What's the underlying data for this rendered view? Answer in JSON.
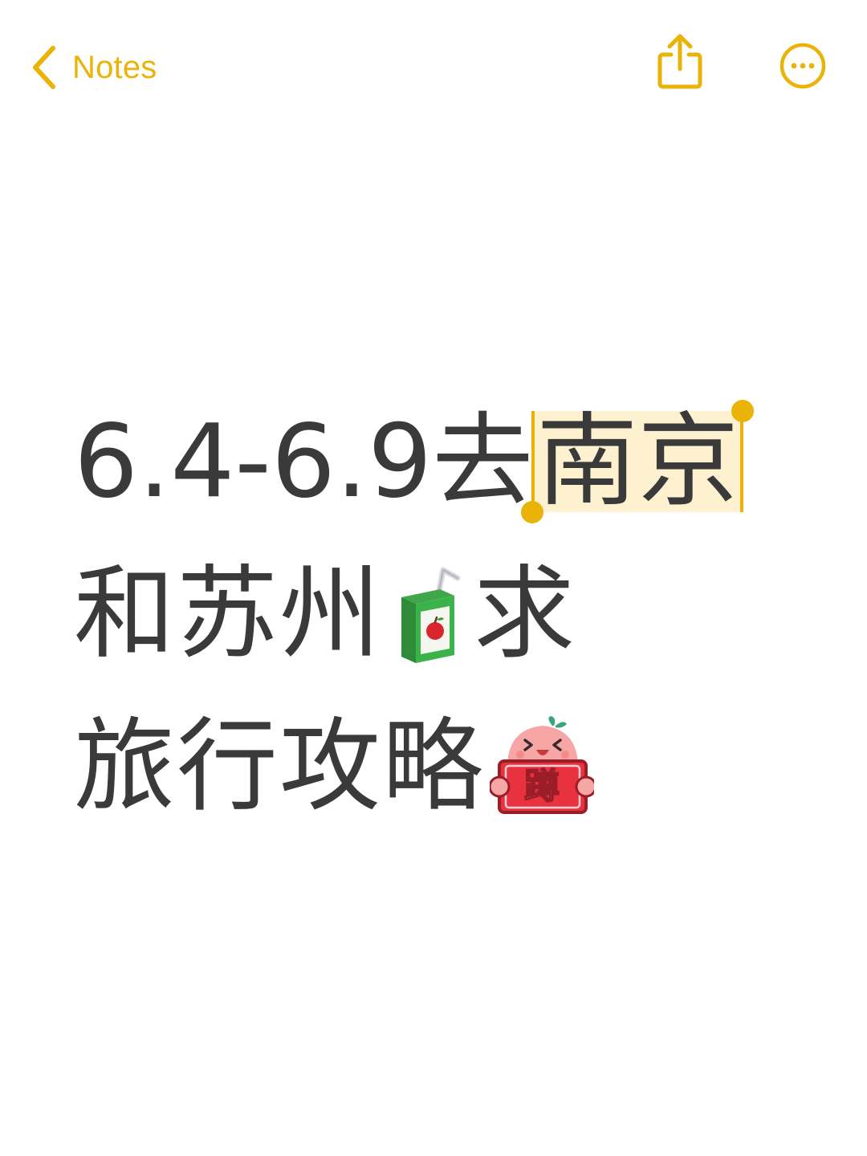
{
  "nav": {
    "back_label": "Notes",
    "back_icon": "chevron-left-icon",
    "share_icon": "share-icon",
    "more_icon": "ellipsis-circle-icon",
    "accent_color": "#e9b308"
  },
  "note": {
    "line1_before": "6.4-6.9去",
    "line1_selected": "南京",
    "line2_text": "和苏州",
    "line2_emoji": "juice-box-emoji",
    "line2_after": "求",
    "line3_text": "旅行攻略",
    "line3_sticker": "蹲",
    "text_color": "#3a3a3a",
    "selection_color": "#fdf1cf"
  }
}
